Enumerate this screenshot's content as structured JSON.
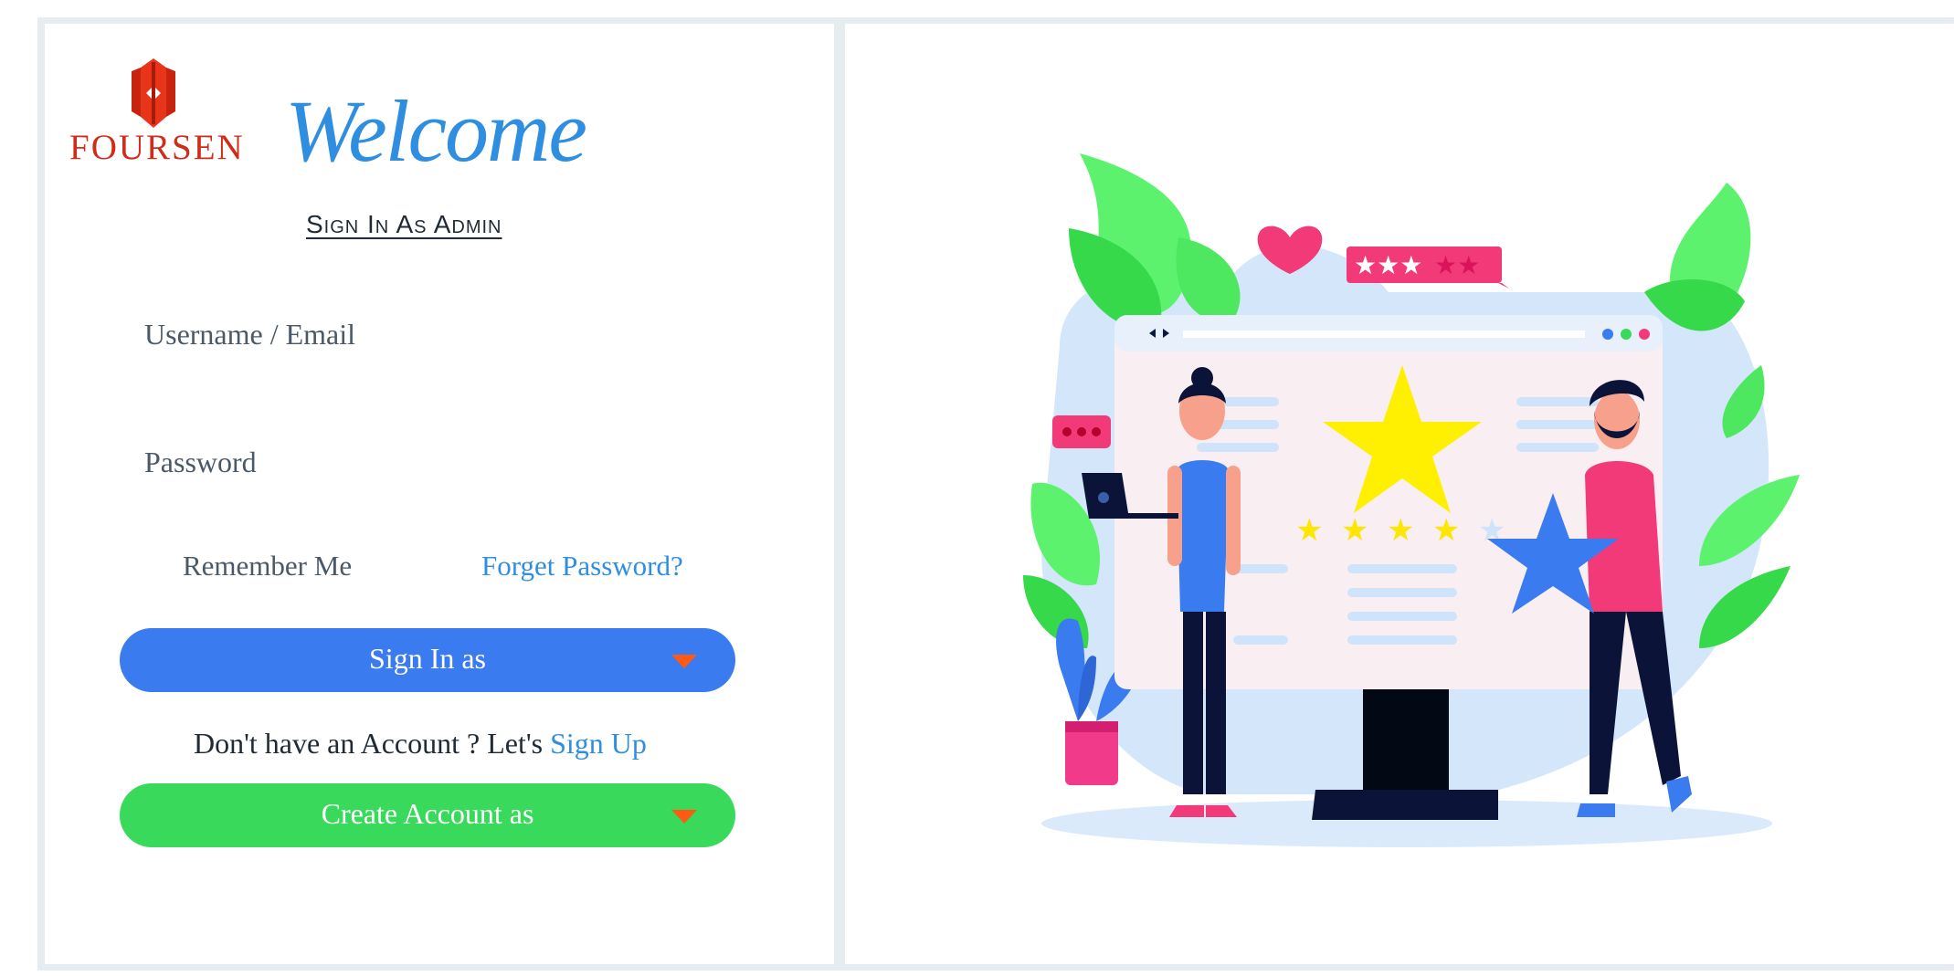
{
  "brand": {
    "name": "FOURSEN",
    "color": "#cf2d1c"
  },
  "header": {
    "welcome": "Welcome",
    "subtitle": "Sign In As Admin"
  },
  "form": {
    "username_placeholder": "Username / Email",
    "password_placeholder": "Password",
    "remember_label": "Remember Me",
    "forgot_label": "Forget Password?"
  },
  "actions": {
    "signin_label": "Sign In as",
    "signup_prompt": "Don't have an Account ? Let's",
    "signup_link": "Sign Up",
    "create_label": "Create Account as"
  },
  "colors": {
    "accent_blue": "#3a7bf0",
    "accent_green": "#39d95b",
    "link_blue": "#2f8ee0",
    "caret_orange": "#ff5a14"
  },
  "icons": [
    "fousen-logo-icon",
    "dropdown-caret-icon",
    "review-illustration"
  ]
}
